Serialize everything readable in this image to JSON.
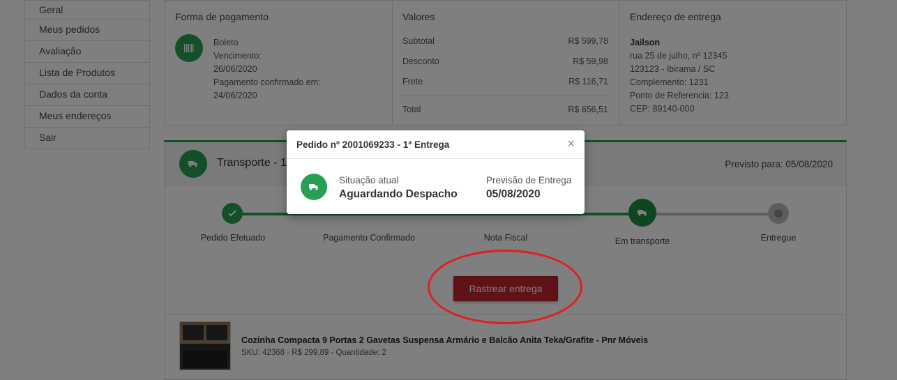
{
  "sidebar": {
    "items": [
      {
        "label": "Geral"
      },
      {
        "label": "Meus pedidos"
      },
      {
        "label": "Avaliação"
      },
      {
        "label": "Lista de Produtos"
      },
      {
        "label": "Dados da conta"
      },
      {
        "label": "Meus endereços"
      },
      {
        "label": "Sair"
      }
    ]
  },
  "payment": {
    "title": "Forma de pagamento",
    "icon": "barcode-icon",
    "lines": [
      "Boleto",
      "Vencimento:",
      "26/06/2020",
      "Pagamento confirmado em:",
      "24/06/2020"
    ]
  },
  "values": {
    "title": "Valores",
    "rows": [
      {
        "label": "Subtotal",
        "value": "R$ 599,78"
      },
      {
        "label": "Desconto",
        "value": "R$ 59,98"
      },
      {
        "label": "Frete",
        "value": "R$ 116,71"
      },
      {
        "label": "Total",
        "value": "R$ 656,51"
      }
    ]
  },
  "address": {
    "title": "Endereço de entrega",
    "name": "Jailson",
    "lines": [
      "rua 25 de julho, nº 12345",
      "123123 - Ibirama / SC",
      "Complemento: 1231",
      "Ponto de Referencia: 123",
      "CEP: 89140-000"
    ]
  },
  "shipment": {
    "title": "Transporte - 1",
    "forecast": "Previsto para: 05/08/2020",
    "icon": "truck-icon",
    "accent": "#27a052",
    "steps": [
      {
        "label": "Pedido Efetuado",
        "state": "done"
      },
      {
        "label": "Pagamento Confirmado",
        "state": "done"
      },
      {
        "label": "Nota Fiscal",
        "state": "done"
      },
      {
        "label": "Em transporte",
        "state": "current"
      },
      {
        "label": "Entregue",
        "state": "pending"
      }
    ],
    "track_button": "Rastrear entrega",
    "track_button_color": "#c1272d",
    "highlight_color": "#e31d25"
  },
  "product": {
    "name": "Cozinha Compacta 9 Portas 2 Gavetas Suspensa Armário e Balcão Anita Teka/Grafite - Pnr Móveis",
    "meta": "SKU: 42368 - R$ 299,89 - Quantidade: 2"
  },
  "modal": {
    "title": "Pedido nº 2001069233 - 1ª Entrega",
    "close": "×",
    "status_label": "Situação atual",
    "status_value": "Aguardando Despacho",
    "forecast_label": "Previsão de Entrega",
    "forecast_value": "05/08/2020",
    "icon": "truck-icon"
  }
}
